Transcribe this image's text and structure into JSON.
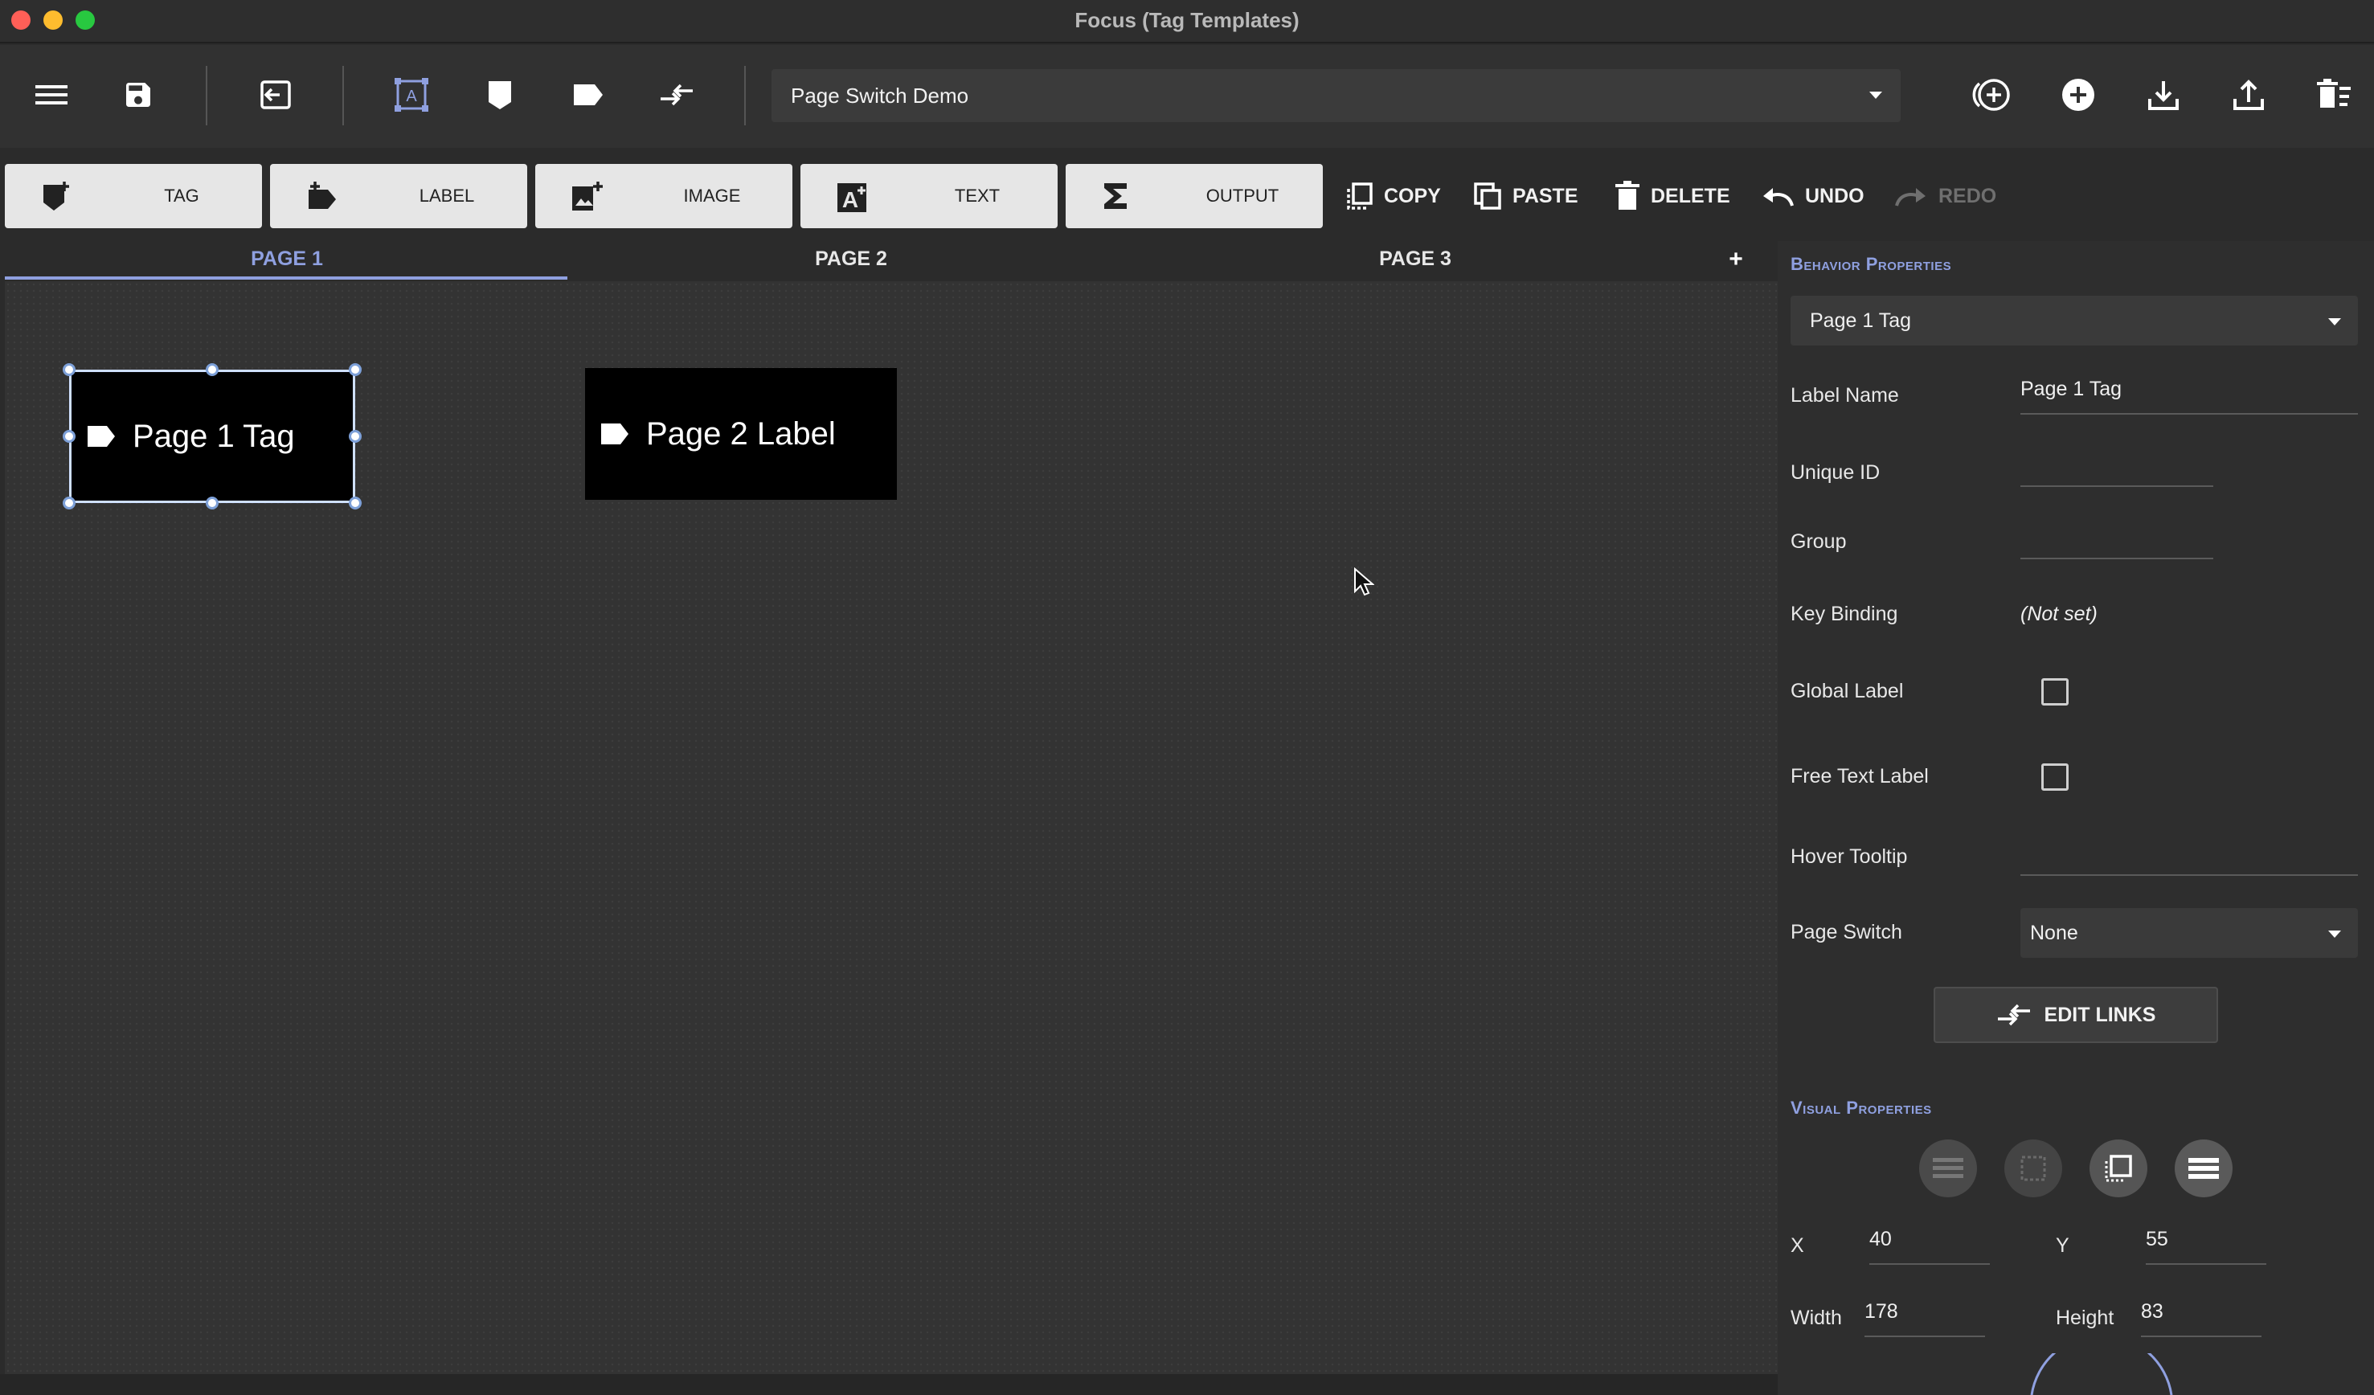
{
  "window": {
    "title": "Focus (Tag Templates)"
  },
  "toolbar": {
    "icons": [
      "menu-icon",
      "save-icon",
      "import-icon",
      "select-region-icon",
      "tag-shape-icon",
      "label-shape-icon",
      "page-switch-link-icon",
      "add-circle-outline-icon",
      "add-circle-filled-icon",
      "download-icon",
      "upload-icon",
      "delete-list-icon"
    ],
    "template_select": {
      "value": "Page Switch Demo"
    }
  },
  "element_bar": {
    "tag": "TAG",
    "label": "LABEL",
    "image": "IMAGE",
    "text": "TEXT",
    "output": "OUTPUT",
    "copy": "COPY",
    "paste": "PASTE",
    "delete": "DELETE",
    "undo": "UNDO",
    "redo": "REDO"
  },
  "tabs": [
    {
      "label": "PAGE 1",
      "active": true
    },
    {
      "label": "PAGE 2",
      "active": false
    },
    {
      "label": "PAGE 3",
      "active": false
    }
  ],
  "add_tab": "+",
  "canvas": {
    "elements": [
      {
        "label": "Page 1 Tag",
        "selected": true
      },
      {
        "label": "Page 2 Label",
        "selected": false
      }
    ]
  },
  "behavior": {
    "header": "Behavior Properties",
    "selected": "Page 1 Tag",
    "label_name": {
      "label": "Label Name",
      "value": "Page 1 Tag"
    },
    "unique_id": {
      "label": "Unique ID",
      "value": ""
    },
    "group": {
      "label": "Group",
      "value": ""
    },
    "key_binding": {
      "label": "Key Binding",
      "value": "(Not set)"
    },
    "global_label": {
      "label": "Global Label",
      "checked": false
    },
    "free_text_label": {
      "label": "Free Text Label",
      "checked": false
    },
    "hover_tooltip": {
      "label": "Hover Tooltip",
      "value": ""
    },
    "page_switch": {
      "label": "Page Switch",
      "value": "None"
    },
    "edit_links": "EDIT LINKS"
  },
  "visual": {
    "header": "Visual Properties",
    "x": {
      "label": "X",
      "value": "40"
    },
    "y": {
      "label": "Y",
      "value": "55"
    },
    "width": {
      "label": "Width",
      "value": "178"
    },
    "height": {
      "label": "Height",
      "value": "83"
    }
  },
  "colors": {
    "accent": "#8fa0e0",
    "canvas": "#333333",
    "panel": "#2e2e2e",
    "element_bg": "#000000"
  }
}
